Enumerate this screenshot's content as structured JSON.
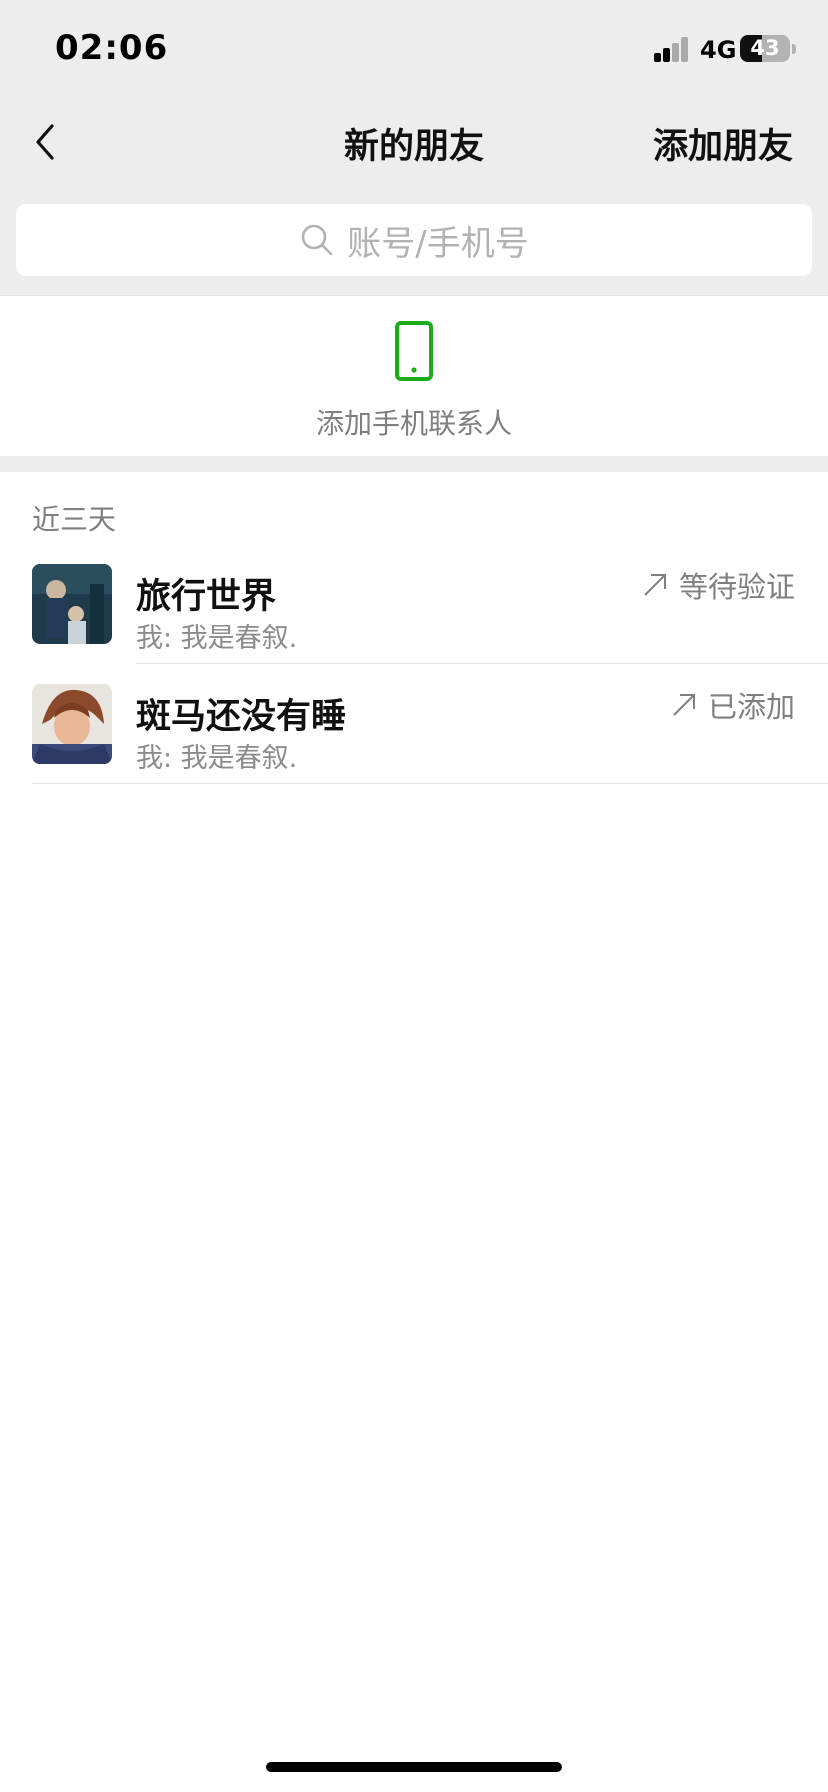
{
  "status_bar": {
    "time": "02:06",
    "network": "4G",
    "battery": "43"
  },
  "nav": {
    "title": "新的朋友",
    "action": "添加朋友"
  },
  "search": {
    "placeholder": "账号/手机号"
  },
  "add_phone": {
    "label": "添加手机联系人"
  },
  "section": {
    "title": "近三天"
  },
  "contacts": [
    {
      "name": "旅行世界",
      "message": "我: 我是春叙.",
      "status": "等待验证"
    },
    {
      "name": "斑马还没有睡",
      "message": "我: 我是春叙.",
      "status": "已添加"
    }
  ],
  "colors": {
    "accent": "#1aad19",
    "background": "#ededed"
  }
}
